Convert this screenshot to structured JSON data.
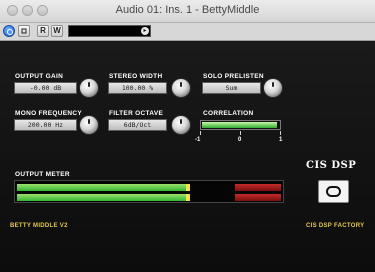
{
  "window": {
    "title": "Audio 01: Ins. 1 - BettyMiddle"
  },
  "toolbar": {
    "r_label": "R",
    "w_label": "W"
  },
  "controls": {
    "output_gain": {
      "label": "OUTPUT GAIN",
      "value": "-0.00 dB"
    },
    "stereo_width": {
      "label": "STEREO WIDTH",
      "value": "100.00 %"
    },
    "solo_prelisten": {
      "label": "SOLO PRELISTEN",
      "value": "Sum"
    },
    "mono_frequency": {
      "label": "MONO FREQUENCY",
      "value": "200.00 Hz"
    },
    "filter_octave": {
      "label": "FILTER OCTAVE",
      "value": "6dB/Oct"
    },
    "correlation": {
      "label": "CORRELATION",
      "scale": [
        "-1",
        "0",
        "1"
      ],
      "level": 0.95
    }
  },
  "output_meter": {
    "label": "OUTPUT METER",
    "left_level": 0.64,
    "right_level": 0.64,
    "peak": 0.64
  },
  "brand": {
    "logo_text": "CIS DSP",
    "product": "BETTY MIDDLE V2",
    "maker": "CIS DSP FACTORY"
  },
  "colors": {
    "meter_green": "#35b535",
    "meter_red": "#b31f1f",
    "peak_yellow": "#f2e14a",
    "footer_gold": "#e9c84a"
  }
}
